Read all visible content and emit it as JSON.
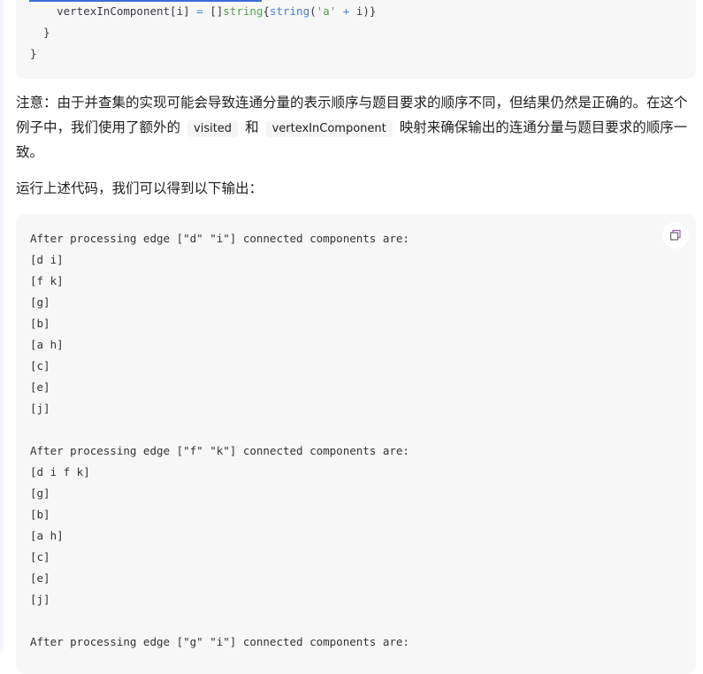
{
  "code_block": {
    "lines": [
      {
        "indent": "    ",
        "var": "vertexInComponent[i]",
        "op": " = ",
        "bracket": "[]",
        "type": "string",
        "rest_open": "{",
        "fn": "string",
        "paren": "(",
        "str": "'a'",
        "plus": " + ",
        "tail": "i)}"
      },
      {
        "text": "  }"
      },
      {
        "text": "}"
      }
    ]
  },
  "note": {
    "part1": "注意：由于并查集的实现可能会导致连通分量的表示顺序与题目要求的顺序不同，但结果仍然是正确的。在这个例子中，我们使用了额外的",
    "code1": "visited",
    "part2": "和",
    "code2": "vertexInComponent",
    "part3": "映射来确保输出的连通分量与题目要求的顺序一致。"
  },
  "intro": "运行上述代码，我们可以得到以下输出：",
  "output": {
    "copy_icon": "copy-icon",
    "text": "After processing edge [\"d\" \"i\"] connected components are:\n[d i]\n[f k]\n[g]\n[b]\n[a h]\n[c]\n[e]\n[j]\n\nAfter processing edge [\"f\" \"k\"] connected components are:\n[d i f k]\n[g]\n[b]\n[a h]\n[c]\n[e]\n[j]\n\nAfter processing edge [\"g\" \"i\"] connected components are:"
  }
}
